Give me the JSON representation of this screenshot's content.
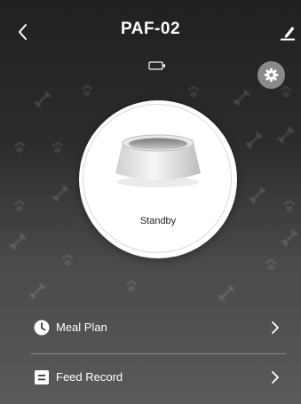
{
  "header": {
    "title": "PAF-02",
    "back_icon": "chevron-left-icon",
    "edit_icon": "pencil-icon"
  },
  "device": {
    "battery_icon": "battery-empty-icon",
    "settings_icon": "gear-icon",
    "status": "Standby"
  },
  "menu": {
    "items": [
      {
        "label": "Meal Plan",
        "icon": "clock-icon"
      },
      {
        "label": "Feed Record",
        "icon": "record-icon"
      }
    ]
  },
  "colors": {
    "background_top": "#202020",
    "background_bottom": "#5a5a5a",
    "settings_button": "#8a8a8a"
  }
}
